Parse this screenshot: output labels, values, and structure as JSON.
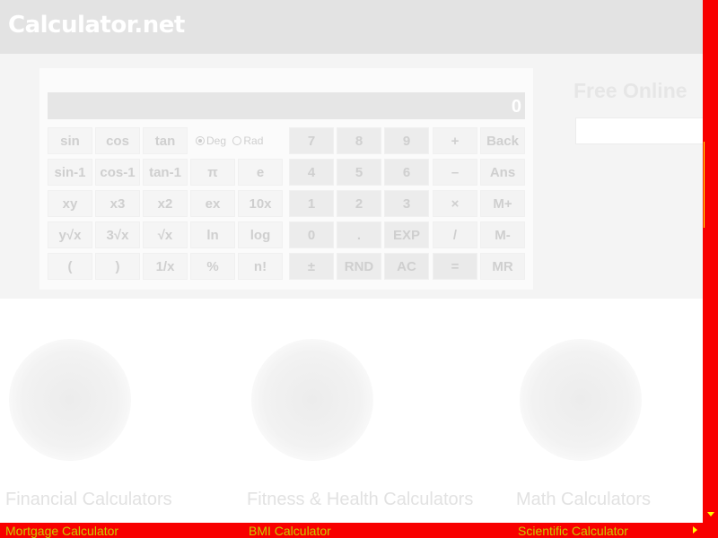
{
  "header": {
    "logo": "Calculator.net"
  },
  "calculator": {
    "display": "0",
    "angle_options": [
      "Deg",
      "Rad"
    ],
    "selected_angle": "Deg",
    "buttons": {
      "sin": "sin",
      "cos": "cos",
      "tan": "tan",
      "asin": "sin-1",
      "acos": "cos-1",
      "atan": "tan-1",
      "pi": "π",
      "e": "e",
      "pow": "xy",
      "cube": "x3",
      "square": "x2",
      "exp_e": "ex",
      "pow10": "10x",
      "root_y": "y√x",
      "cube_root": "3√x",
      "sqrt": "√x",
      "ln": "ln",
      "log": "log",
      "paren_open": "(",
      "paren_close": ")",
      "reciprocal": "1/x",
      "percent": "%",
      "factorial": "n!",
      "n7": "7",
      "n8": "8",
      "n9": "9",
      "plus": "+",
      "back": "Back",
      "n4": "4",
      "n5": "5",
      "n6": "6",
      "minus": "–",
      "ans": "Ans",
      "n1": "1",
      "n2": "2",
      "n3": "3",
      "times": "×",
      "mplus": "M+",
      "n0": "0",
      "dot": ".",
      "exp": "EXP",
      "divide": "/",
      "mminus": "M-",
      "plusminus": "±",
      "rnd": "RND",
      "ac": "AC",
      "equals": "=",
      "mr": "MR"
    }
  },
  "sidebar": {
    "title": "Free Online"
  },
  "categories": [
    {
      "title": "Financial Calculators",
      "link": "Mortgage Calculator"
    },
    {
      "title": "Fitness & Health Calculators",
      "link": "BMI Calculator"
    },
    {
      "title": "Math Calculators",
      "link": "Scientific Calculator"
    }
  ]
}
